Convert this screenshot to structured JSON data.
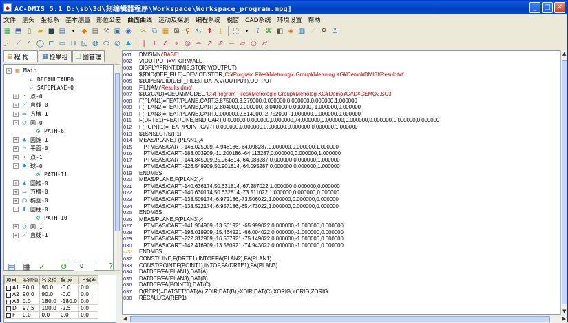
{
  "window": {
    "title": "AC-DMIS 5.1     D:\\sb\\3d\\刻编辑器程序\\Workspace\\Workspace_program.mpg]"
  },
  "menu": [
    "文件",
    "测头",
    "坐标系",
    "基本测量",
    "形位公差",
    "曲面曲线",
    "运动及探测",
    "编程系统",
    "視窗",
    "CAD系统",
    "环境设置",
    "帮助"
  ],
  "left": {
    "tabs": [
      "程 构...",
      "检果组",
      "图管理"
    ],
    "tree": [
      {
        "text": "Main",
        "indent": 0,
        "pm": "-",
        "icon": "folder-icon"
      },
      {
        "text": "DEFAULTAUBO",
        "indent": 2,
        "pm": "",
        "icon": "axis-icon"
      },
      {
        "text": "SAFEPLANE-0",
        "indent": 2,
        "pm": "",
        "icon": "plane-icon"
      },
      {
        "text": "点-0",
        "indent": 1,
        "pm": "+",
        "icon": "point-icon"
      },
      {
        "text": "直线-0",
        "indent": 1,
        "pm": "+",
        "icon": "line-icon"
      },
      {
        "text": "方槽-1",
        "indent": 1,
        "pm": "+",
        "icon": "slot-icon"
      },
      {
        "text": "圆-0",
        "indent": 1,
        "pm": "-",
        "icon": "circle-icon"
      },
      {
        "text": "PATH-6",
        "indent": 3,
        "pm": "",
        "icon": "path-icon"
      },
      {
        "text": "圆锥-1",
        "indent": 1,
        "pm": "+",
        "icon": "cone-icon"
      },
      {
        "text": "平面-0",
        "indent": 1,
        "pm": "+",
        "icon": "plane-icon"
      },
      {
        "text": "点-1",
        "indent": 1,
        "pm": "+",
        "icon": "point-icon"
      },
      {
        "text": "球-0",
        "indent": 1,
        "pm": "-",
        "icon": "sphere-icon"
      },
      {
        "text": "PATH-11",
        "indent": 3,
        "pm": "",
        "icon": "path-icon"
      },
      {
        "text": "圆锥-0",
        "indent": 1,
        "pm": "+",
        "icon": "cone-icon"
      },
      {
        "text": "方槽-0",
        "indent": 1,
        "pm": "+",
        "icon": "slot-icon"
      },
      {
        "text": "椭圆-0",
        "indent": 1,
        "pm": "+",
        "icon": "ellipse-icon"
      },
      {
        "text": "圆柱-0",
        "indent": 1,
        "pm": "-",
        "icon": "cylinder-icon"
      },
      {
        "text": "PATH-10",
        "indent": 3,
        "pm": "",
        "icon": "path-icon"
      },
      {
        "text": "圆-1",
        "indent": 1,
        "pm": "+",
        "icon": "circle-icon"
      },
      {
        "text": "直线-1",
        "indent": 1,
        "pm": "+",
        "icon": "line-icon"
      }
    ],
    "counter_value": "0",
    "grid": {
      "headers": [
        "项目",
        "实测值",
        "名义值",
        "偏 差",
        "上偏差"
      ],
      "rows": [
        [
          "A1",
          "90.0",
          "90.0",
          "-0.0",
          "0.0"
        ],
        [
          "A2",
          "90.0",
          "90.0",
          "-0.0",
          "0.0"
        ],
        [
          "A3",
          "0.0",
          "180.0",
          "-180.0",
          "0.0"
        ],
        [
          "D",
          "97.5",
          "100.0",
          "-2.5",
          "0.0"
        ],
        [
          "F",
          "0.0",
          "0.0",
          "0.0",
          "0.0"
        ]
      ]
    }
  },
  "code": [
    {
      "n": "001",
      "t": "DMISMN/",
      "s": "'BASE'",
      "r": ""
    },
    {
      "n": "002",
      "t": "V(OUTPUT)=VFORM/ALL",
      "s": "",
      "r": ""
    },
    {
      "n": "003",
      "t": "DISPLY/PRINT,DMIS,STOR,V(OUTPUT)",
      "s": "",
      "r": ""
    },
    {
      "n": "004",
      "t": "$$DID(DEF_FILE)=DEVICE/STOR,",
      "s": "'C:¥Program Files¥Metrologic Group¥Metrolog XG¥Demo¥DMIS¥Result.txt'",
      "r": ""
    },
    {
      "n": "005",
      "t": "$$OPEN/DID(DEF_FILE),FDATA,V(OUTPUT),OUTPUT",
      "s": "",
      "r": ""
    },
    {
      "n": "006",
      "t": "FILNAM/",
      "s": "'Results dmo'",
      "r": ""
    },
    {
      "n": "007",
      "t": "$$G(CAD)=GEOM/MODEL,",
      "s": "'C:¥Program Files¥Metrologic Group¥Metrolog XG¥Demo¥CAD¥DEMO2.SU3'",
      "r": ""
    },
    {
      "n": "008",
      "t": "F(PLAN1)=FEAT/PLANE,CART,3.875000,3.379000,0.000000,0.000000,0.000000,1.000000",
      "s": "",
      "r": ""
    },
    {
      "n": "009",
      "t": "F(PLAN2)=FEAT/PLANE,CART,2.804000,0.000000,-3.040000,0.000000,-1.000000,0.000000",
      "s": "",
      "r": ""
    },
    {
      "n": "010",
      "t": "F(PLAN3)=FEAT/PLANE,CART,0.000000,2.814000,-2.752000,-1.000000,0.000000,0.000000",
      "s": "",
      "r": ""
    },
    {
      "n": "011",
      "t": "F(DRTE1)=FEAT/LINE,BND,CART,0.000000,0.000000,0.000000,74.000000,0.000000,0.000000,0.000000,1.000000,0.000000",
      "s": "",
      "r": ""
    },
    {
      "n": "012",
      "t": "F(POINT1)=FEAT/POINT,CART,0.000000,0.000000,0.000000,0.000000,0.000000,1.000000",
      "s": "",
      "r": ""
    },
    {
      "n": "013",
      "t": "$$SNSLCT/S(P1)",
      "s": "",
      "r": ""
    },
    {
      "n": "014",
      "t": "MEAS/PLANE,F(PLAN1),4",
      "s": "",
      "r": ""
    },
    {
      "n": "015",
      "t": "   PTMEAS/CART,-146.025909,-4.948186,-64.098287,0.000000,0.000000,1.000000",
      "s": "",
      "r": ""
    },
    {
      "n": "016",
      "t": "   PTMEAS/CART,-188.003909,-11.200186,-64.113287,0.000000,0.000000,1.000000",
      "s": "",
      "r": ""
    },
    {
      "n": "017",
      "t": "   PTMEAS/CART,-144.845909,25.964814,-64.083287,0.000000,0.000000,1.000000",
      "s": "",
      "r": ""
    },
    {
      "n": "018",
      "t": "   PTMEAS/CART,-226.549909,50.901814,-64.095287,0.000000,0.000000,1.000000",
      "s": "",
      "r": ""
    },
    {
      "n": "019",
      "t": "ENDMES",
      "s": "",
      "r": ""
    },
    {
      "n": "020",
      "t": "MEAS/PLANE,F(PLAN2),4",
      "s": "",
      "r": ""
    },
    {
      "n": "021",
      "t": "   PTMEAS/CART,-140.636174,50.631814,-67.287022,1.000000,0.000000,0.000000",
      "s": "",
      "r": ""
    },
    {
      "n": "022",
      "t": "   PTMEAS/CART,-140.630174,50.632814,-73.511022,1.000000,0.000000,0.000000",
      "s": "",
      "r": ""
    },
    {
      "n": "023",
      "t": "   PTMEAS/CART,-138.509174,-6.972186,-73.506022,1.000000,0.000000,0.000000",
      "s": "",
      "r": ""
    },
    {
      "n": "024",
      "t": "   PTMEAS/CART,-138.522174,-6.957186,-65.473022,1.000000,0.000000,0.000000",
      "s": "",
      "r": ""
    },
    {
      "n": "025",
      "t": "ENDMES",
      "s": "",
      "r": ""
    },
    {
      "n": "026",
      "t": "MEAS/PLANE,F(PLAN3),4",
      "s": "",
      "r": ""
    },
    {
      "n": "027",
      "t": "   PTMEAS/CART,-141.904909,-13.561921,-65.999022,0.000000,-1.000000,0.000000",
      "s": "",
      "r": ""
    },
    {
      "n": "028",
      "t": "   PTMEAS/CART,-193.019909,-15.464921,-66.004022,0.000000,-1.000000,0.000000",
      "s": "",
      "r": ""
    },
    {
      "n": "029",
      "t": "   PTMEAS/CART,-222.312909,-16.537921,-75.149022,0.000000,-1.000000,0.000000",
      "s": "",
      "r": ""
    },
    {
      "n": "030",
      "t": "   PTMEAS/CART,-142.416909,-13.580921,-74.943022,0.000000,-1.000000,0.000000",
      "s": "",
      "r": ""
    },
    {
      "n": "031",
      "t": "ENDMES",
      "s": "",
      "r": "",
      "mark": true
    },
    {
      "n": "032",
      "t": "CONST/LINE,F(DRTE1),INTOF,FA(PLAN2),FA(PLAN1)",
      "s": "",
      "r": ""
    },
    {
      "n": "033",
      "t": "CONST/POINT,F(POINT1),INTOF,FA(DRTE1),FA(PLAN3)",
      "s": "",
      "r": ""
    },
    {
      "n": "034",
      "t": "DATDEF/FA(PLAN1),DAT(A)",
      "s": "",
      "r": ""
    },
    {
      "n": "035",
      "t": "DATDEF/FA(PLAN3),DAT(B)",
      "s": "",
      "r": ""
    },
    {
      "n": "036",
      "t": "DATDEF/FA(POINT1),DAT(C)",
      "s": "",
      "r": ""
    },
    {
      "n": "037",
      "t": "D(REP1)=DATSET/DAT(A),ZDIR,DAT(B),-XDIR,DAT(C),XORIG,YORIG,ZORIG",
      "s": "",
      "r": ""
    },
    {
      "n": "038",
      "t": "RECALL/DA(REP1)",
      "s": "",
      "r": ""
    }
  ]
}
